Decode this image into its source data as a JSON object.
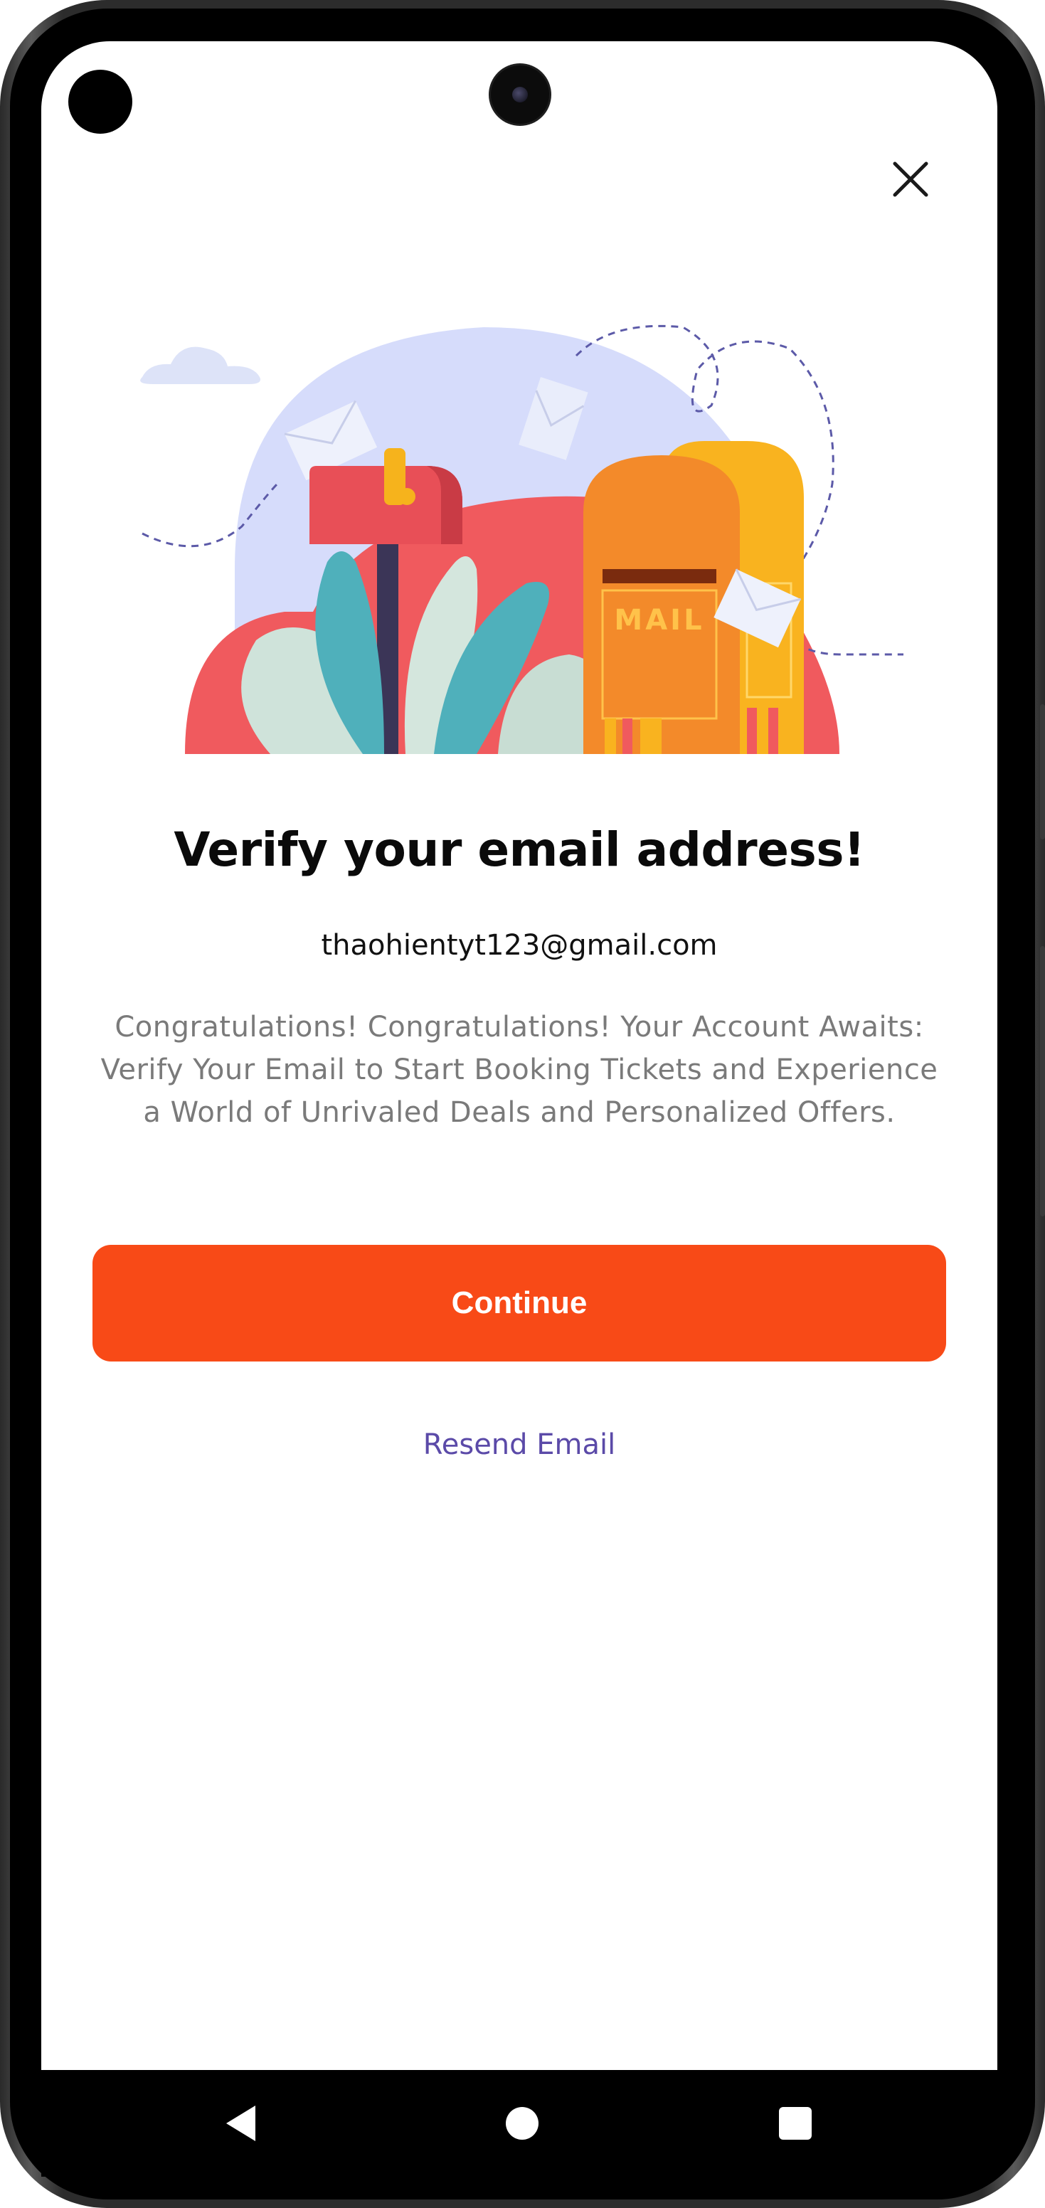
{
  "dialog": {
    "title": "Verify your email address!",
    "email": "thaohientyt123@gmail.com",
    "description": "Congratulations! Congratulations! Your Account Awaits: Verify Your Email to Start Booking Tickets and Experience a World of Unrivaled Deals and Personalized Offers.",
    "continue_label": "Continue",
    "resend_label": "Resend Email",
    "close_icon": "close-icon"
  },
  "illustration": {
    "mailbox_text": "MAIL"
  },
  "colors": {
    "accent": "#f84a17",
    "link": "#5b4aa8",
    "title": "#0a0a0a",
    "description": "#7a7a7a"
  },
  "system_nav": {
    "back_icon": "back-triangle-icon",
    "home_icon": "home-circle-icon",
    "recents_icon": "recents-square-icon"
  }
}
